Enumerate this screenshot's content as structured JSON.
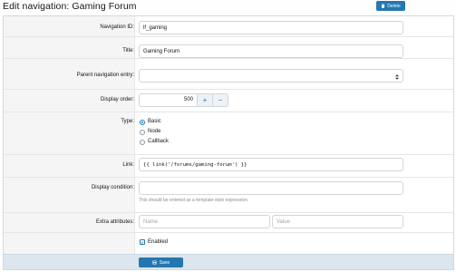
{
  "header": {
    "title": "Edit navigation: Gaming Forum",
    "delete_label": "Delete"
  },
  "form": {
    "navigation_id": {
      "label": "Navigation ID:",
      "value": "lf_gaming"
    },
    "title": {
      "label": "Title:",
      "value": "Gaming Forum"
    },
    "parent": {
      "label": "Parent navigation entry:",
      "value": ""
    },
    "display_order": {
      "label": "Display order:",
      "value": "500",
      "plus": "+",
      "minus": "−"
    },
    "type": {
      "label": "Type:",
      "options": [
        "Basic",
        "Node",
        "Callback"
      ],
      "selected": "Basic"
    },
    "link": {
      "label": "Link:",
      "value": "{{ link('/forums/gaming-forum') }}"
    },
    "display_condition": {
      "label": "Display condition:",
      "value": "",
      "hint": "This should be entered as a template-style expression."
    },
    "extra_attributes": {
      "label": "Extra attributes:",
      "name_placeholder": "Name",
      "value_placeholder": "Value"
    },
    "enabled": {
      "label": "Enabled",
      "checked": true
    }
  },
  "footer": {
    "save_label": "Save"
  },
  "colors": {
    "primary": "#2577b1",
    "label_bg": "#f5f5f5",
    "footer_bg": "#dbe6ef",
    "border": "#d3d5d7"
  }
}
